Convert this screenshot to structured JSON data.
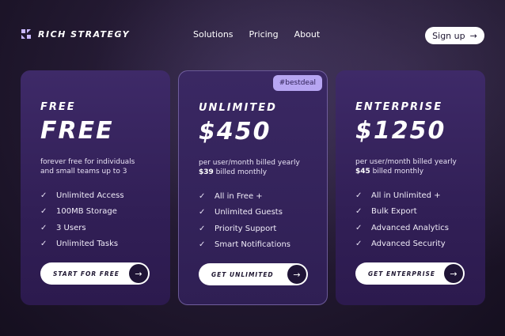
{
  "brand": {
    "name": "RICH STRATEGY",
    "logo_icon": "rs-logo-icon"
  },
  "nav": {
    "items": [
      "Solutions",
      "Pricing",
      "About"
    ]
  },
  "header": {
    "signup_label": "Sign up",
    "signup_icon": "arrow-right-icon"
  },
  "colors": {
    "accent": "#b7a6f2",
    "card": "#3a2863",
    "button": "#ffffff",
    "button_dark": "#1f1436"
  },
  "plans": [
    {
      "name": "FREE",
      "price": "FREE",
      "desc_line1": "forever free for individuals",
      "desc_line2": "and small teams up to 3",
      "monthly_price": "",
      "monthly_suffix": "",
      "features": [
        "Unlimited Access",
        "100MB Storage",
        "3 Users",
        "Unlimited Tasks"
      ],
      "cta": "START FOR FREE"
    },
    {
      "name": "UNLIMITED",
      "badge": "#bestdeal",
      "price": "$450",
      "desc_line1": "per user/month billed yearly",
      "monthly_price": "$39",
      "monthly_suffix": " billed monthly",
      "features": [
        "All in Free +",
        "Unlimited Guests",
        "Priority Support",
        "Smart Notifications"
      ],
      "cta": "GET UNLIMITED"
    },
    {
      "name": "ENTERPRISE",
      "price": "$1250",
      "desc_line1": "per user/month billed yearly",
      "monthly_price": "$45",
      "monthly_suffix": " billed monthly",
      "features": [
        "All in Unlimited +",
        "Bulk Export",
        "Advanced Analytics",
        "Advanced Security"
      ],
      "cta": "GET ENTERPRISE"
    }
  ]
}
